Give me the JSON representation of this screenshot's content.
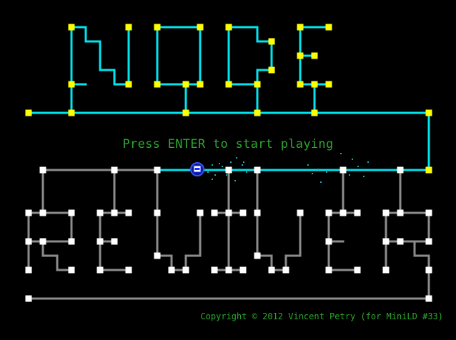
{
  "title_top": "NODE",
  "title_bottom": "REVIVER",
  "prompt": "Press ENTER to start playing",
  "copyright": "Copyright © 2012 Vincent Petry (for MiniLD #33)",
  "colors": {
    "background": "#000000",
    "active_wire": "#00e5ee",
    "active_node": "#ffff00",
    "inactive_wire": "#8c8c8c",
    "inactive_node": "#ffffff",
    "text": "#2ea82e",
    "player": "#1830ff"
  },
  "player_icon": "player-orb-icon"
}
